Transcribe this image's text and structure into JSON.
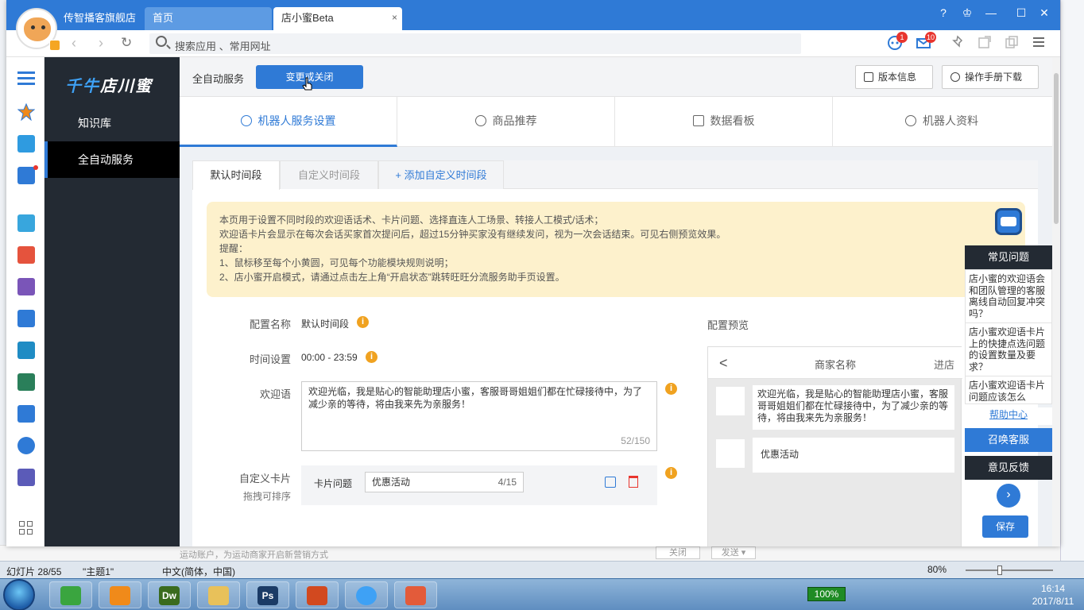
{
  "colors": {
    "primary": "#2f7ad6",
    "dark": "#232a33",
    "notice_bg": "#fdf1cc",
    "warn": "#f0a220",
    "danger": "#e8352e"
  },
  "window": {
    "store_name": "传智播客旗舰店",
    "tabs": [
      {
        "label": "首页"
      },
      {
        "label": "店小蜜Beta",
        "close": "×"
      }
    ],
    "controls": {
      "help": "?",
      "shirt": "♔",
      "min": "—",
      "max": "☐",
      "close": "✕"
    }
  },
  "addrbar": {
    "search_placeholder": "搜索应用 、常用网址",
    "badge_robot": "1",
    "badge_mail": "10"
  },
  "sidebar": {
    "brand_a": "千牛",
    "brand_b": "店川蜜",
    "items": [
      {
        "label": "知识库"
      },
      {
        "label": "全自动服务"
      }
    ]
  },
  "topstrip": {
    "label": "全自动服务",
    "change_button": "变更或关闭",
    "version_button": "版本信息",
    "manual_button": "操作手册下载"
  },
  "main_tabs": [
    {
      "label": "机器人服务设置"
    },
    {
      "label": "商品推荐"
    },
    {
      "label": "数据看板"
    },
    {
      "label": "机器人资料"
    }
  ],
  "sub_tabs": [
    {
      "label": "默认时间段"
    },
    {
      "label": "自定义时间段"
    },
    {
      "label": "+ 添加自定义时间段"
    }
  ],
  "notice": {
    "lines": [
      "本页用于设置不同时段的欢迎语话术、卡片问题、选择直连人工场景、转接人工模式/话术；",
      "欢迎语卡片会显示在每次会话买家首次提问后，超过15分钟买家没有继续发问，视为一次会话结束。可见右侧预览效果。",
      "提醒：",
      "1、鼠标移至每个小黄圆，可见每个功能模块规则说明；",
      "2、店小蜜开启模式，请通过点击左上角“开启状态”跳转旺旺分流服务助手页设置。"
    ]
  },
  "form": {
    "config_name_label": "配置名称",
    "config_name_value": "默认时间段",
    "time_label": "时间设置",
    "time_value": "00:00 - 23:59",
    "welcome_label": "欢迎语",
    "welcome_value": "欢迎光临，我是贴心的智能助理店小蜜，客服哥哥姐姐们都在忙碌接待中，为了减少亲的等待，将由我来先为亲服务！",
    "welcome_count": "52/150",
    "card_label": "自定义卡片",
    "card_sub_label": "拖拽可排序",
    "card_question_label": "卡片问题",
    "card_question_value": "优惠活动",
    "card_question_count": "4/15",
    "info_glyph": "i"
  },
  "preview": {
    "label": "配置预览",
    "back": "<",
    "merchant": "商家名称",
    "enter": "进店",
    "welcome": "欢迎光临，我是贴心的智能助理店小蜜，客服哥哥姐姐们都在忙碌接待中，为了减少亲的等待，将由我来先为亲服务！",
    "card": "优惠活动"
  },
  "faq": {
    "title": "常见问题",
    "items": [
      "店小蜜的欢迎语会和团队管理的客服离线自动回复冲突吗？",
      "店小蜜欢迎语卡片上的快捷点选问题的设置数量及要求？",
      "店小蜜欢迎语卡片问题应该怎么"
    ],
    "help": "帮助中心",
    "call": "召唤客服",
    "feedback": "意见反馈",
    "next": "›"
  },
  "save_button": "保存",
  "background": {
    "ppt_text": "运动账户，为运动商家开启新营销方式",
    "ppt_btn1": "关闭",
    "ppt_btn2": "发送 ▾",
    "status_slide": "幻灯片 28/55",
    "status_theme": "\"主题1\"",
    "status_lang": "中文(简体，中国)",
    "zoom": "80%"
  },
  "taskbar": {
    "battery": "100%",
    "time": "16:14",
    "date": "2017/8/11",
    "apps": [
      "",
      "",
      "Dw",
      "",
      "Ps",
      "",
      "",
      ""
    ]
  }
}
